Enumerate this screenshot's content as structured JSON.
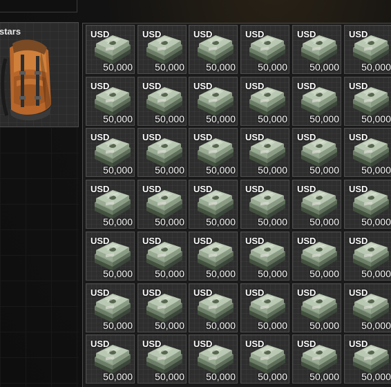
{
  "backpack": {
    "name": "stars",
    "icon": "orange-backpack-icon"
  },
  "stash": {
    "rows": 7,
    "cols": 6,
    "item": {
      "currency": "USD",
      "amount": "50,000",
      "icon": "dollar-stack-icon"
    }
  },
  "colors": {
    "background": "#141414",
    "cell": "#2e2e2e",
    "cell_border": "#4e4e4e",
    "text": "#ffffff"
  }
}
